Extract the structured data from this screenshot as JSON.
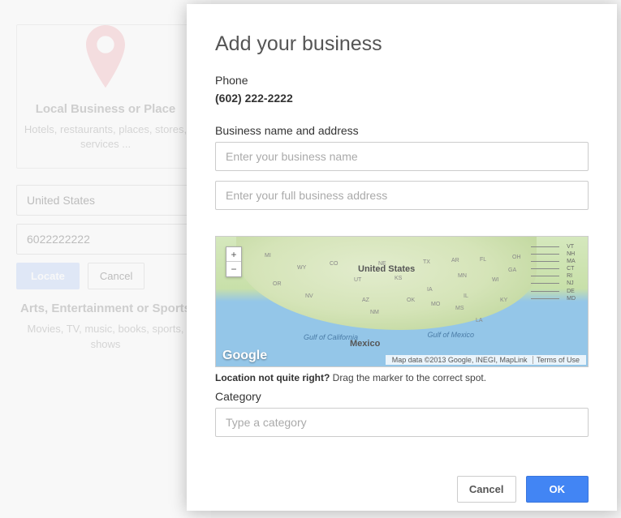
{
  "background": {
    "card_title": "Local Business or Place",
    "card_subtitle": "Hotels, restaurants, places, stores, services ...",
    "country_value": "United States",
    "phone_value": "6022222222",
    "locate_btn": "Locate",
    "cancel_btn": "Cancel",
    "section2_title": "Arts, Entertainment or Sports",
    "section2_sub": "Movies, TV, music, books, sports, shows"
  },
  "modal": {
    "title": "Add your business",
    "phone_label": "Phone",
    "phone_value": "(602) 222-2222",
    "name_addr_label": "Business name and address",
    "name_placeholder": "Enter your business name",
    "addr_placeholder": "Enter your full business address",
    "map": {
      "logo": "Google",
      "label_us": "United States",
      "label_mexico": "Mexico",
      "gulf_ca": "Gulf of\nCalifornia",
      "gulf_mx": "Gulf of\nMexico",
      "attribution": "Map data ©2013 Google, INEGI, MapLink",
      "terms": "Terms of Use",
      "states_scatter": [
        "OR",
        "WY",
        "NV",
        "CO",
        "UT",
        "AZ",
        "NM",
        "NE",
        "KS",
        "OK",
        "TX",
        "IA",
        "MO",
        "AR",
        "MN",
        "IL",
        "MS",
        "LA",
        "FL",
        "WI",
        "KY",
        "GA",
        "OH",
        "MI"
      ],
      "east_states": [
        "VT",
        "NH",
        "MA",
        "CT",
        "RI",
        "NJ",
        "DE",
        "MD"
      ]
    },
    "hint_bold": "Location not quite right?",
    "hint_rest": " Drag the marker to the correct spot.",
    "category_label": "Category",
    "category_placeholder": "Type a category",
    "cancel_btn": "Cancel",
    "ok_btn": "OK"
  }
}
